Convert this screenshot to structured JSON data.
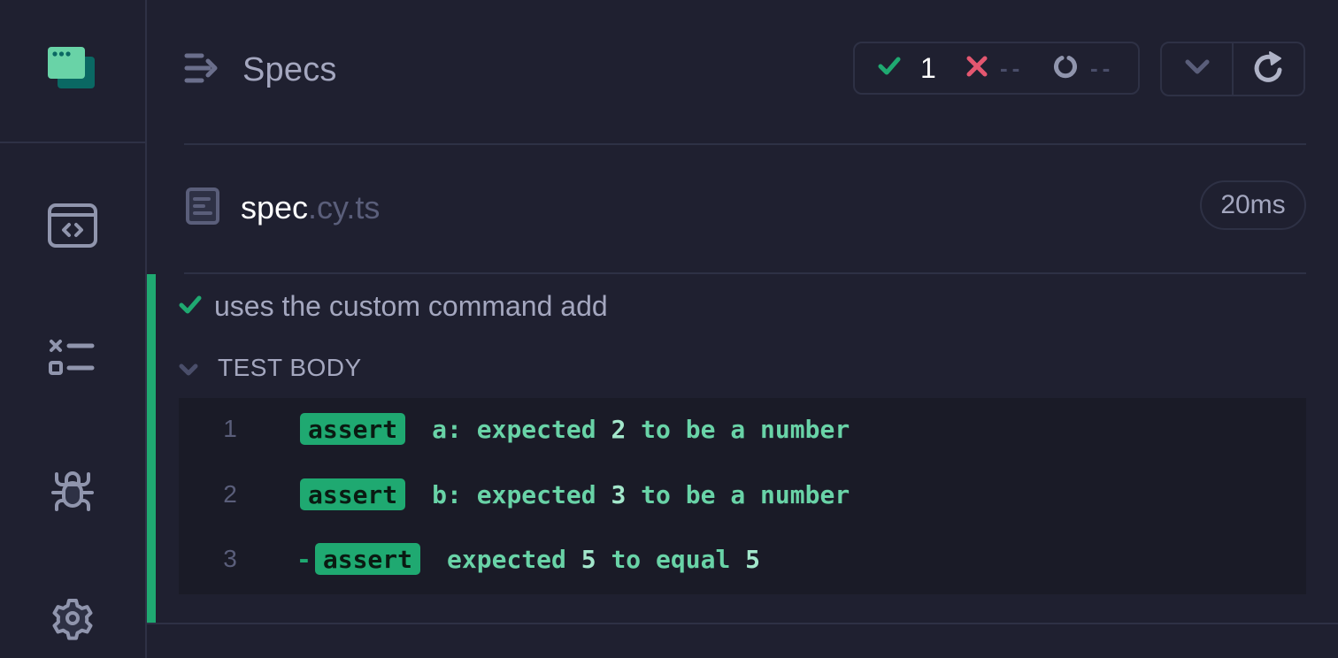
{
  "sidebar": {
    "logo": "cypress-app-logo",
    "items": [
      {
        "name": "specs-browser",
        "icon": "code-window-icon"
      },
      {
        "name": "runs",
        "icon": "test-results-icon"
      },
      {
        "name": "debug",
        "icon": "bug-icon"
      },
      {
        "name": "settings",
        "icon": "gear-icon"
      }
    ]
  },
  "header": {
    "title": "Specs",
    "stats": {
      "passed": "1",
      "failed": "--",
      "pending": "--"
    }
  },
  "spec": {
    "base_name": "spec",
    "extension": ".cy.ts",
    "duration": "20ms"
  },
  "test": {
    "status": "passed",
    "title": "uses the custom command add",
    "section": "TEST BODY",
    "commands": [
      {
        "number": "1",
        "prefix": "",
        "name": "assert",
        "parts": [
          "a: expected ",
          "2",
          " to be a number"
        ]
      },
      {
        "number": "2",
        "prefix": "",
        "name": "assert",
        "parts": [
          "b: expected ",
          "3",
          " to be a number"
        ]
      },
      {
        "number": "3",
        "prefix": "-",
        "name": "assert",
        "parts": [
          "expected ",
          "5",
          " to equal ",
          "5"
        ]
      }
    ]
  },
  "colors": {
    "background": "#1f2030",
    "passed": "#1fa971",
    "failed": "#e45770",
    "muted": "#a4a7bf",
    "code_text": "#69d3a7"
  }
}
